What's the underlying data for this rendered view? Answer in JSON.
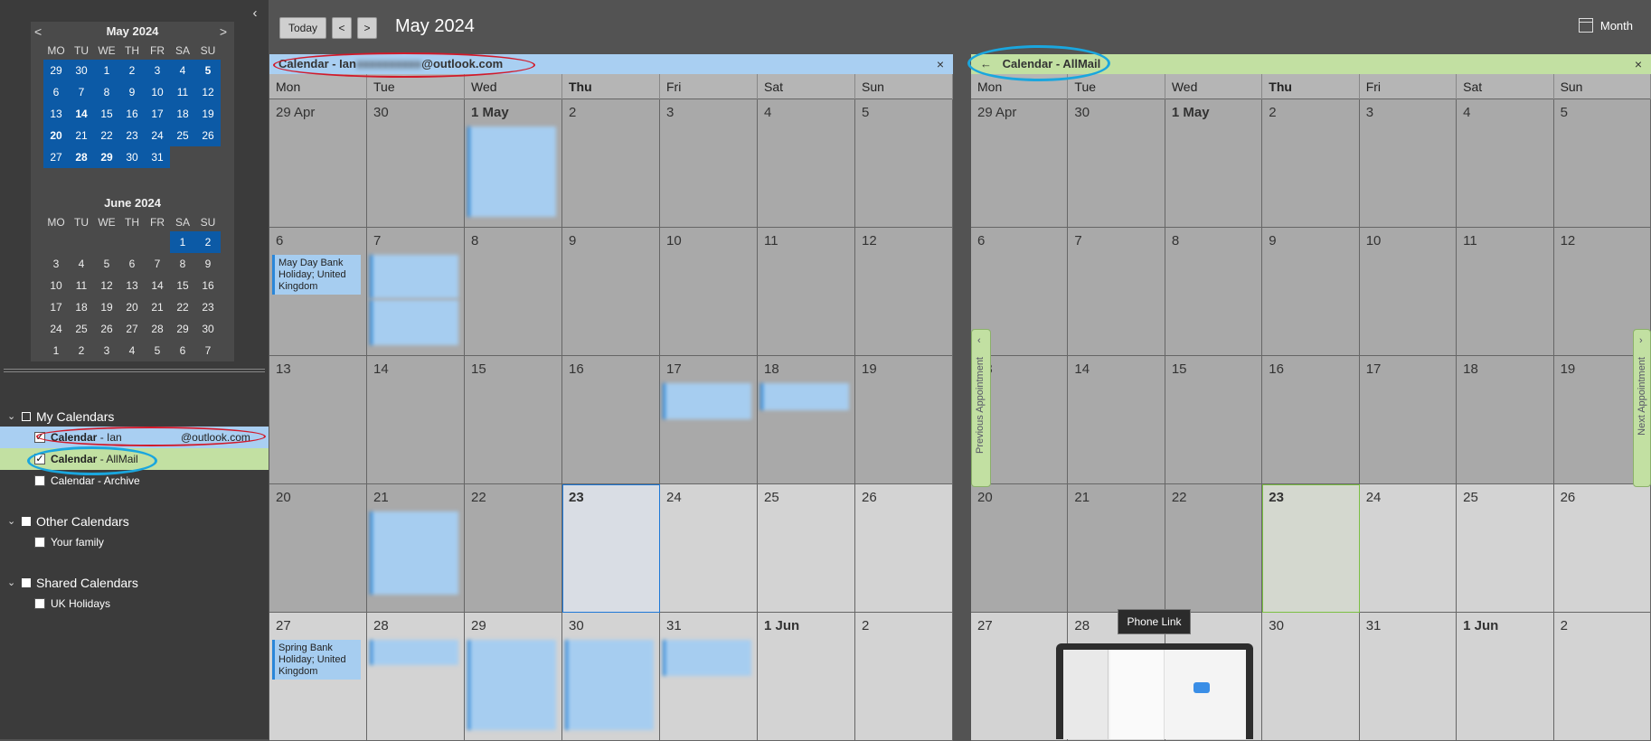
{
  "sidebar": {
    "collapse_icon": "‹",
    "mini_may": {
      "title": "May 2024",
      "prev": "<",
      "next": ">",
      "dows": [
        "MO",
        "TU",
        "WE",
        "TH",
        "FR",
        "SA",
        "SU"
      ],
      "days": [
        "29",
        "30",
        "1",
        "2",
        "3",
        "4",
        "5",
        "6",
        "7",
        "8",
        "9",
        "10",
        "11",
        "12",
        "13",
        "14",
        "15",
        "16",
        "17",
        "18",
        "19",
        "20",
        "21",
        "22",
        "23",
        "24",
        "25",
        "26",
        "27",
        "28",
        "29",
        "30",
        "31"
      ],
      "bold": [
        6,
        15,
        21,
        29,
        30
      ]
    },
    "mini_june": {
      "title": "June 2024",
      "dows": [
        "MO",
        "TU",
        "WE",
        "TH",
        "FR",
        "SA",
        "SU"
      ],
      "days": [
        "",
        "",
        "",
        "",
        "",
        "1",
        "2",
        "3",
        "4",
        "5",
        "6",
        "7",
        "8",
        "9",
        "10",
        "11",
        "12",
        "13",
        "14",
        "15",
        "16",
        "17",
        "18",
        "19",
        "20",
        "21",
        "22",
        "23",
        "24",
        "25",
        "26",
        "27",
        "28",
        "29",
        "30",
        "1",
        "2",
        "3",
        "4",
        "5",
        "6",
        "7"
      ]
    },
    "groups": [
      {
        "label": "My Calendars",
        "items": [
          {
            "name": "Calendar",
            "suffix": " - Ian",
            "extra": "@outlook.com",
            "checked": true,
            "style": "blue"
          },
          {
            "name": "Calendar",
            "suffix": " - AllMail",
            "extra": "",
            "checked": true,
            "style": "green"
          },
          {
            "name": "Calendar - Archive",
            "suffix": "",
            "extra": "",
            "checked": false,
            "style": ""
          }
        ]
      },
      {
        "label": "Other Calendars",
        "items": [
          {
            "name": "Your family",
            "suffix": "",
            "extra": "",
            "checked": false,
            "style": ""
          }
        ]
      },
      {
        "label": "Shared Calendars",
        "items": [
          {
            "name": "UK Holidays",
            "suffix": "",
            "extra": "",
            "checked": false,
            "style": ""
          }
        ]
      }
    ]
  },
  "toolbar": {
    "today_label": "Today",
    "prev_label": "<",
    "next_label": ">",
    "month_title": "May 2024",
    "view_label": "Month"
  },
  "pane1": {
    "header": "Calendar - Ian",
    "header_tail": "@outlook.com",
    "close": "×",
    "dows": [
      "Mon",
      "Tue",
      "Wed",
      "Thu",
      "Fri",
      "Sat",
      "Sun"
    ],
    "days": [
      "29 Apr",
      "30",
      "1 May",
      "2",
      "3",
      "4",
      "5",
      "6",
      "7",
      "8",
      "9",
      "10",
      "11",
      "12",
      "13",
      "14",
      "15",
      "16",
      "17",
      "18",
      "19",
      "20",
      "21",
      "22",
      "23",
      "24",
      "25",
      "26",
      "27",
      "28",
      "29",
      "30",
      "31",
      "1 Jun",
      "2"
    ],
    "events": {
      "event_may6": "May Day Bank Holiday; United Kingdom",
      "event_may27": "Spring Bank Holiday; United Kingdom"
    }
  },
  "pane2": {
    "back": "←",
    "header": "Calendar - AllMail",
    "close": "×",
    "dows": [
      "Mon",
      "Tue",
      "Wed",
      "Thu",
      "Fri",
      "Sat",
      "Sun"
    ],
    "days": [
      "29 Apr",
      "30",
      "1 May",
      "2",
      "3",
      "4",
      "5",
      "6",
      "7",
      "8",
      "9",
      "10",
      "11",
      "12",
      "13",
      "14",
      "15",
      "16",
      "17",
      "18",
      "19",
      "20",
      "21",
      "22",
      "23",
      "24",
      "25",
      "26",
      "27",
      "28",
      "29",
      "30",
      "31",
      "1 Jun",
      "2"
    ],
    "prev_appt": "Previous Appointment",
    "next_appt": "Next Appointment"
  },
  "tooltip": "Phone Link"
}
